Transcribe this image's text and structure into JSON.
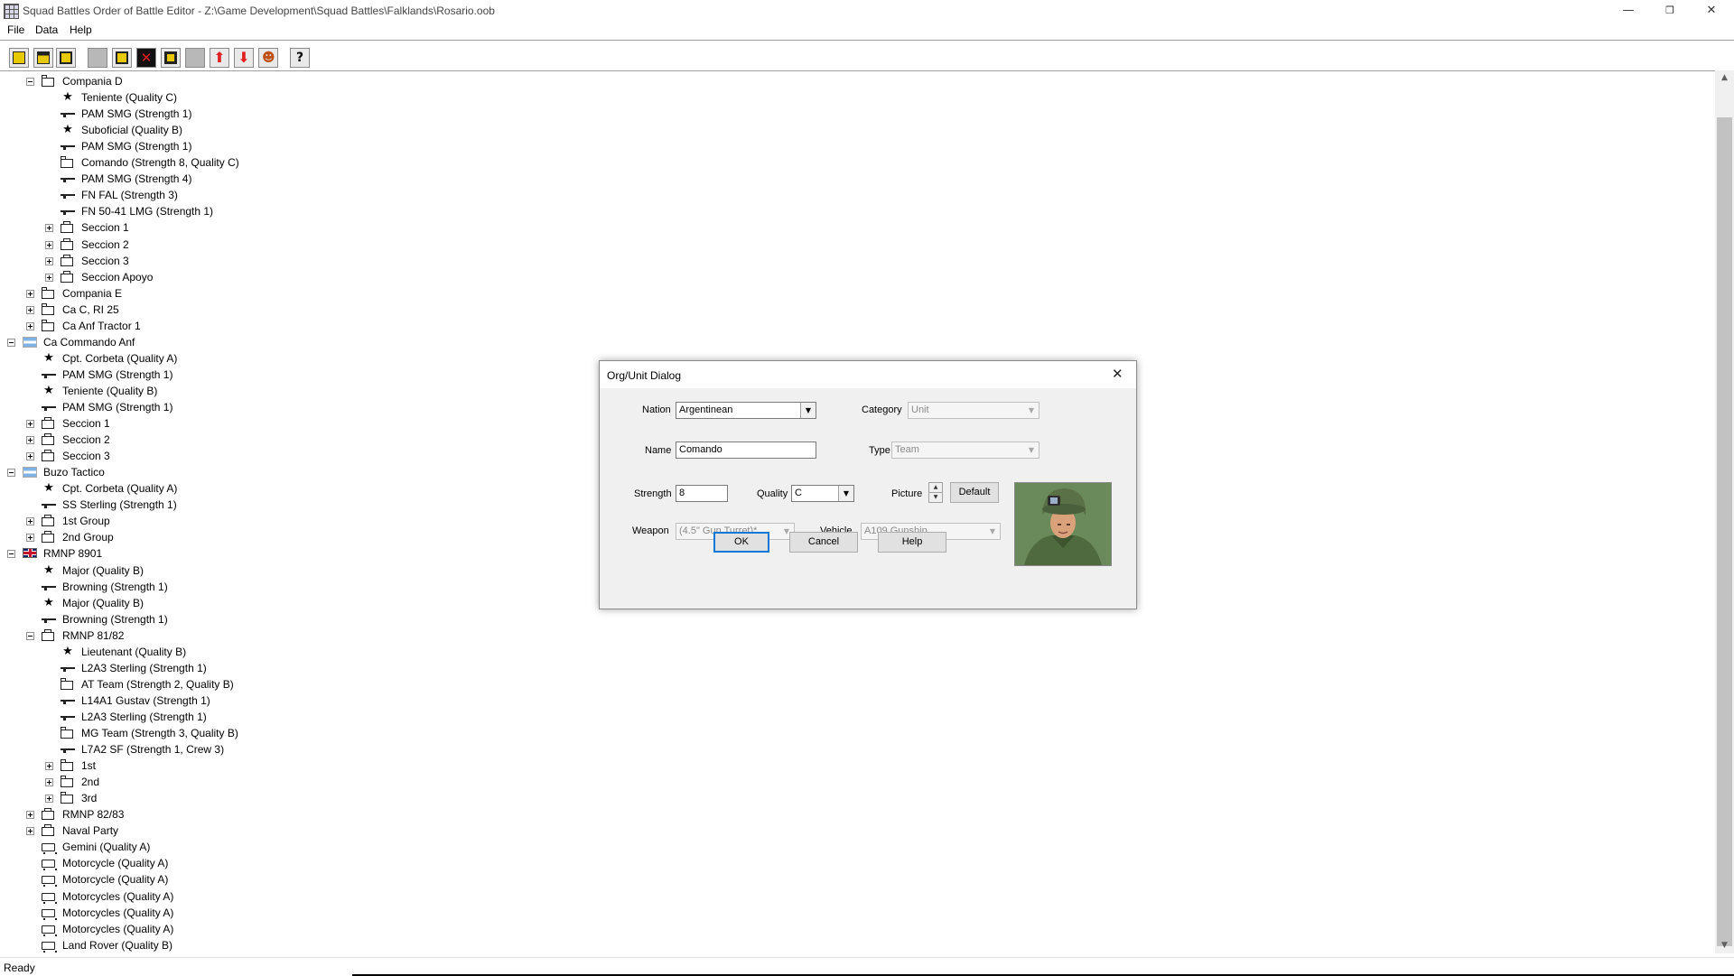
{
  "window": {
    "title": "Squad Battles Order of Battle Editor - Z:\\Game Development\\Squad Battles\\Falklands\\Rosario.oob"
  },
  "menu": {
    "file": "File",
    "data": "Data",
    "help": "Help"
  },
  "status": {
    "text": "Ready"
  },
  "tree": [
    {
      "label": "Compania D",
      "icon": "org",
      "level": 2,
      "exp": "minus"
    },
    {
      "label": "Teniente (Quality C)",
      "icon": "star",
      "level": 3
    },
    {
      "label": "PAM SMG (Strength 1)",
      "icon": "gun",
      "level": 3
    },
    {
      "label": "Suboficial (Quality B)",
      "icon": "star",
      "level": 3
    },
    {
      "label": "PAM SMG (Strength 1)",
      "icon": "gun",
      "level": 3
    },
    {
      "label": "Comando (Strength 8, Quality C)",
      "icon": "org",
      "level": 3
    },
    {
      "label": "PAM SMG (Strength 4)",
      "icon": "gun",
      "level": 3
    },
    {
      "label": "FN FAL (Strength 3)",
      "icon": "gun",
      "level": 3
    },
    {
      "label": "FN 50-41 LMG (Strength 1)",
      "icon": "gun",
      "level": 3
    },
    {
      "label": "Seccion 1",
      "icon": "group",
      "level": 3,
      "exp": "plus"
    },
    {
      "label": "Seccion 2",
      "icon": "group",
      "level": 3,
      "exp": "plus"
    },
    {
      "label": "Seccion 3",
      "icon": "group",
      "level": 3,
      "exp": "plus"
    },
    {
      "label": "Seccion Apoyo",
      "icon": "group",
      "level": 3,
      "exp": "plus"
    },
    {
      "label": "Compania E",
      "icon": "org",
      "level": 2,
      "exp": "plus"
    },
    {
      "label": "Ca C, RI 25",
      "icon": "org",
      "level": 2,
      "exp": "plus"
    },
    {
      "label": "Ca Anf Tractor 1",
      "icon": "org",
      "level": 2,
      "exp": "plus"
    },
    {
      "label": "Ca Commando Anf",
      "icon": "flag-arg",
      "level": 1,
      "exp": "minus"
    },
    {
      "label": "Cpt. Corbeta (Quality A)",
      "icon": "star",
      "level": 2
    },
    {
      "label": "PAM SMG (Strength 1)",
      "icon": "gun",
      "level": 2
    },
    {
      "label": "Teniente (Quality B)",
      "icon": "star",
      "level": 2
    },
    {
      "label": "PAM SMG (Strength 1)",
      "icon": "gun",
      "level": 2
    },
    {
      "label": "Seccion 1",
      "icon": "group",
      "level": 2,
      "exp": "plus"
    },
    {
      "label": "Seccion 2",
      "icon": "group",
      "level": 2,
      "exp": "plus"
    },
    {
      "label": "Seccion 3",
      "icon": "group",
      "level": 2,
      "exp": "plus"
    },
    {
      "label": "Buzo Tactico",
      "icon": "flag-arg",
      "level": 1,
      "exp": "minus"
    },
    {
      "label": "Cpt. Corbeta (Quality A)",
      "icon": "star",
      "level": 2
    },
    {
      "label": "SS Sterling (Strength 1)",
      "icon": "gun",
      "level": 2
    },
    {
      "label": "1st Group",
      "icon": "group",
      "level": 2,
      "exp": "plus"
    },
    {
      "label": "2nd Group",
      "icon": "group",
      "level": 2,
      "exp": "plus"
    },
    {
      "label": "RMNP 8901",
      "icon": "flag-uk",
      "level": 1,
      "exp": "minus"
    },
    {
      "label": "Major (Quality B)",
      "icon": "star",
      "level": 2
    },
    {
      "label": "Browning (Strength 1)",
      "icon": "gun",
      "level": 2
    },
    {
      "label": "Major (Quality B)",
      "icon": "star",
      "level": 2
    },
    {
      "label": "Browning (Strength 1)",
      "icon": "gun",
      "level": 2
    },
    {
      "label": "RMNP 81/82",
      "icon": "group",
      "level": 2,
      "exp": "minus"
    },
    {
      "label": "Lieutenant (Quality B)",
      "icon": "star",
      "level": 3
    },
    {
      "label": "L2A3 Sterling (Strength 1)",
      "icon": "gun",
      "level": 3
    },
    {
      "label": "AT Team (Strength 2, Quality B)",
      "icon": "org",
      "level": 3
    },
    {
      "label": "L14A1 Gustav (Strength 1)",
      "icon": "gun",
      "level": 3
    },
    {
      "label": "L2A3 Sterling (Strength 1)",
      "icon": "gun",
      "level": 3
    },
    {
      "label": "MG Team (Strength 3, Quality B)",
      "icon": "org",
      "level": 3
    },
    {
      "label": "L7A2 SF (Strength 1, Crew 3)",
      "icon": "gun",
      "level": 3
    },
    {
      "label": "1st",
      "icon": "org",
      "level": 3,
      "exp": "plus"
    },
    {
      "label": "2nd",
      "icon": "org",
      "level": 3,
      "exp": "plus"
    },
    {
      "label": "3rd",
      "icon": "org",
      "level": 3,
      "exp": "plus"
    },
    {
      "label": "RMNP 82/83",
      "icon": "group",
      "level": 2,
      "exp": "plus"
    },
    {
      "label": "Naval Party",
      "icon": "group",
      "level": 2,
      "exp": "plus"
    },
    {
      "label": "Gemini (Quality A)",
      "icon": "veh",
      "level": 2
    },
    {
      "label": "Motorcycle (Quality A)",
      "icon": "veh",
      "level": 2
    },
    {
      "label": "Motorcycle (Quality A)",
      "icon": "veh",
      "level": 2
    },
    {
      "label": "Motorcycles (Quality A)",
      "icon": "veh",
      "level": 2
    },
    {
      "label": "Motorcycles (Quality A)",
      "icon": "veh",
      "level": 2
    },
    {
      "label": "Motorcycles (Quality A)",
      "icon": "veh",
      "level": 2
    },
    {
      "label": "Land Rover (Quality B)",
      "icon": "veh",
      "level": 2
    }
  ],
  "dialog": {
    "title": "Org/Unit Dialog",
    "nation_label": "Nation",
    "nation_value": "Argentinean",
    "category_label": "Category",
    "category_value": "Unit",
    "name_label": "Name",
    "name_value": "Comando",
    "type_label": "Type",
    "type_value": "Team",
    "strength_label": "Strength",
    "strength_value": "8",
    "quality_label": "Quality",
    "quality_value": "C",
    "picture_label": "Picture",
    "default_label": "Default",
    "weapon_label": "Weapon",
    "weapon_value": "(4.5\" Gun Turret)*",
    "vehicle_label": "Vehicle",
    "vehicle_value": "A109 Gunship",
    "ok_label": "OK",
    "cancel_label": "Cancel",
    "help_label": "Help"
  }
}
